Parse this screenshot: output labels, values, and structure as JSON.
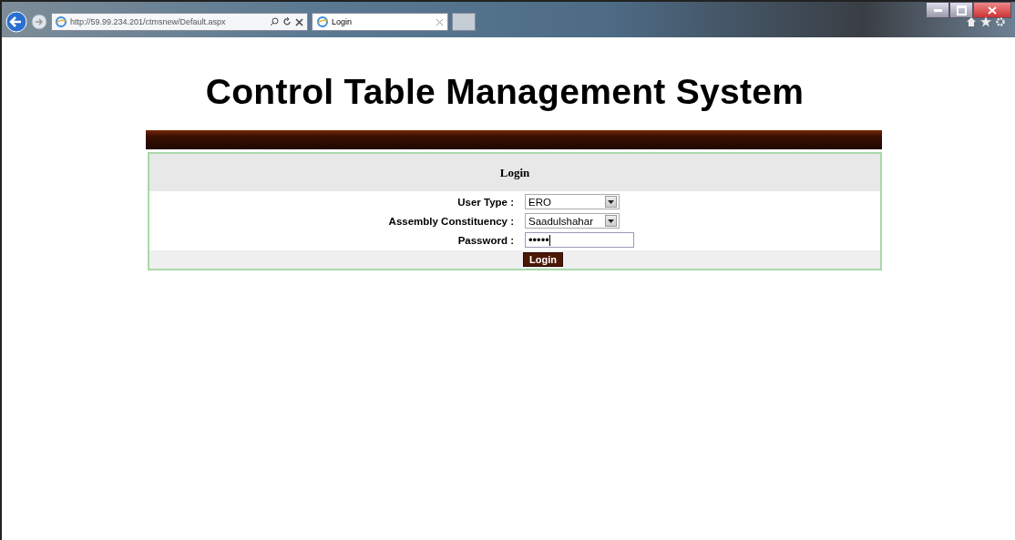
{
  "browser": {
    "url": "http://59.99.234.201/ctmsnew/Default.aspx",
    "tab_title": "Login"
  },
  "page": {
    "title": "Control Table Management System"
  },
  "login_form": {
    "heading": "Login",
    "fields": [
      {
        "kind": "select",
        "label": "User Type :",
        "value": "ERO"
      },
      {
        "kind": "select",
        "label": "Assembly Constituency :",
        "value": "Saadulshahar"
      },
      {
        "kind": "password",
        "label": "Password :",
        "value": "•••••"
      }
    ],
    "button": "Login"
  }
}
